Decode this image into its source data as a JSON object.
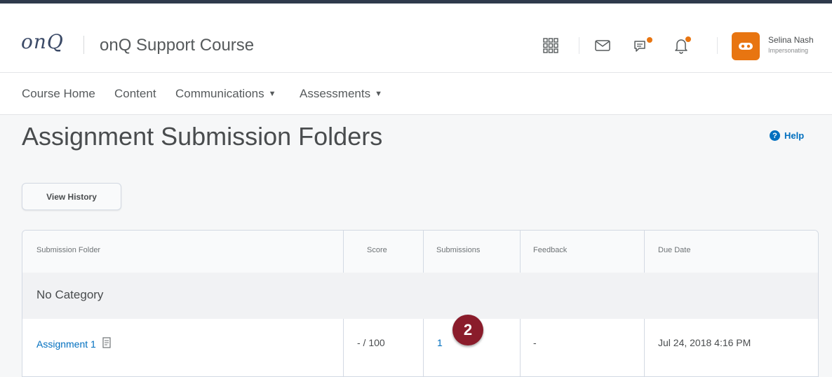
{
  "header": {
    "logo": "onQ",
    "course_title": "onQ Support Course",
    "user": {
      "name": "Selina Nash",
      "status": "Impersonating"
    }
  },
  "nav": {
    "items": [
      {
        "label": "Course Home"
      },
      {
        "label": "Content"
      },
      {
        "label": "Communications"
      },
      {
        "label": "Assessments"
      }
    ]
  },
  "page": {
    "title": "Assignment Submission Folders",
    "help": "Help",
    "view_history": "View History"
  },
  "table": {
    "columns": [
      "Submission Folder",
      "Score",
      "Submissions",
      "Feedback",
      "Due Date"
    ],
    "category": "No Category",
    "rows": [
      {
        "folder": "Assignment 1",
        "score": "- / 100",
        "submissions": "1",
        "feedback": "-",
        "due_date": "Jul 24, 2018 4:16 PM"
      }
    ]
  },
  "callout": {
    "number": "2"
  },
  "colors": {
    "accent": "#006fbf",
    "notify": "#e87511",
    "callout": "#8a1c2b",
    "topbar": "#2f3a4c"
  },
  "icons": [
    "waffle-icon",
    "mail-icon",
    "chat-icon",
    "bell-icon",
    "user-avatar-icon",
    "help-icon",
    "assignment-folder-icon"
  ]
}
